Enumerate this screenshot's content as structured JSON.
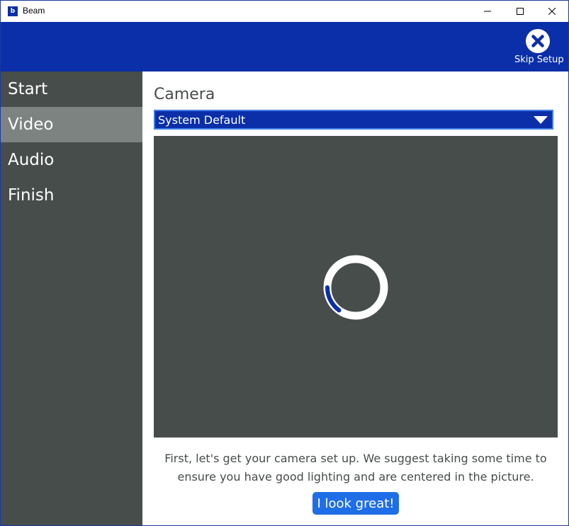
{
  "window": {
    "title": "Beam",
    "app_icon_glyph": "b"
  },
  "header": {
    "skip_setup_label": "Skip Setup",
    "skip_icon": "close-circle-icon"
  },
  "sidebar": {
    "items": [
      {
        "label": "Start",
        "active": false
      },
      {
        "label": "Video",
        "active": true
      },
      {
        "label": "Audio",
        "active": false
      },
      {
        "label": "Finish",
        "active": false
      }
    ]
  },
  "main": {
    "title": "Camera",
    "camera_select": {
      "selected": "System Default"
    },
    "loading_progress": 0.15,
    "description_line1": "First, let's get your camera set up. We suggest taking some time to",
    "description_line2": "ensure you have good lighting and are centered in the picture.",
    "confirm_button_label": "I look great!"
  },
  "colors": {
    "brand_blue": "#0a2fa8",
    "accent_blue": "#1f6ee8",
    "sidebar_bg": "#474d4b",
    "sidebar_active": "#7d8381",
    "preview_bg": "#474d4b"
  }
}
